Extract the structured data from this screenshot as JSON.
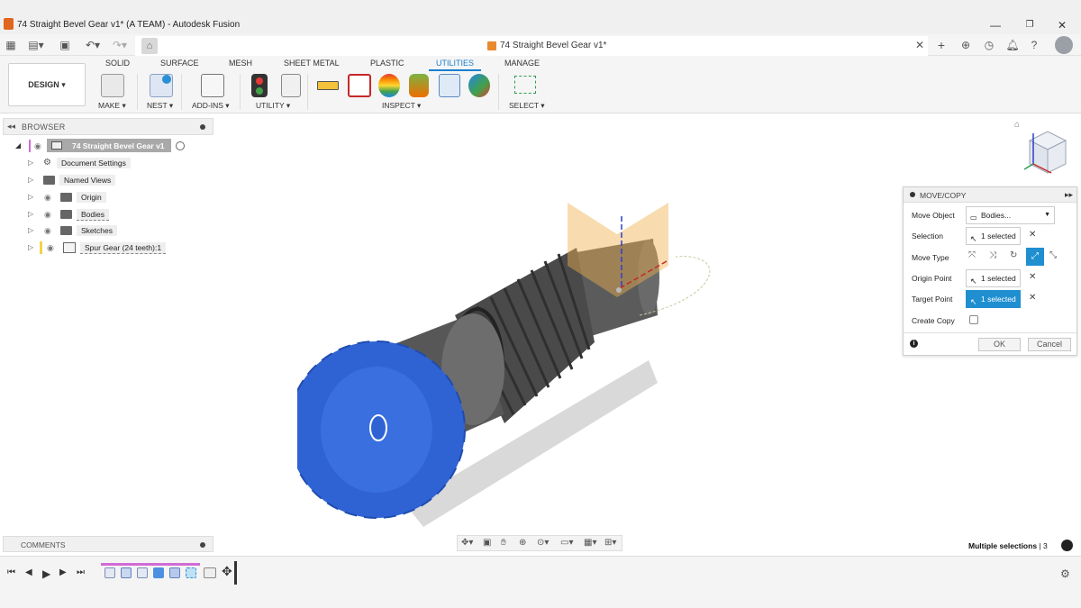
{
  "window": {
    "title": "74 Straight Bevel Gear v1* (A TEAM) - Autodesk Fusion",
    "min_icon": "minimize-icon",
    "max_icon": "maximize-icon",
    "close_icon": "close-icon"
  },
  "document_tab": {
    "title": "74 Straight Bevel Gear v1*"
  },
  "ribbon": {
    "workspace": "DESIGN ▾",
    "tabs": [
      "SOLID",
      "SURFACE",
      "MESH",
      "SHEET METAL",
      "PLASTIC",
      "UTILITIES",
      "MANAGE"
    ],
    "active_tab": "UTILITIES",
    "groups": {
      "make": "MAKE ▾",
      "nest": "NEST ▾",
      "addins": "ADD-INS ▾",
      "utility": "UTILITY ▾",
      "inspect": "INSPECT ▾",
      "select": "SELECT ▾"
    }
  },
  "browser": {
    "title": "BROWSER",
    "root": "74 Straight Bevel Gear v1",
    "items": [
      {
        "label": "Document Settings"
      },
      {
        "label": "Named Views"
      },
      {
        "label": "Origin"
      },
      {
        "label": "Bodies"
      },
      {
        "label": "Sketches"
      },
      {
        "label": "Spur Gear (24 teeth):1"
      }
    ]
  },
  "move_copy": {
    "title": "MOVE/COPY",
    "rows": {
      "move_object_label": "Move Object",
      "move_object_value": "Bodies...",
      "selection_label": "Selection",
      "selection_value": "1 selected",
      "move_type_label": "Move Type",
      "origin_point_label": "Origin Point",
      "origin_point_value": "1 selected",
      "target_point_label": "Target Point",
      "target_point_value": "1 selected",
      "create_copy_label": "Create Copy"
    },
    "ok": "OK",
    "cancel": "Cancel"
  },
  "comments": {
    "title": "COMMENTS"
  },
  "status": {
    "text": "Multiple selections",
    "count": "| 3"
  },
  "colors": {
    "accent": "#1a7fcf",
    "gear_blue": "#2f63d4",
    "shaft_gray": "#5b5b5b",
    "plane_orange": "#f0b24e",
    "timeline_track": "#d26bd6"
  }
}
